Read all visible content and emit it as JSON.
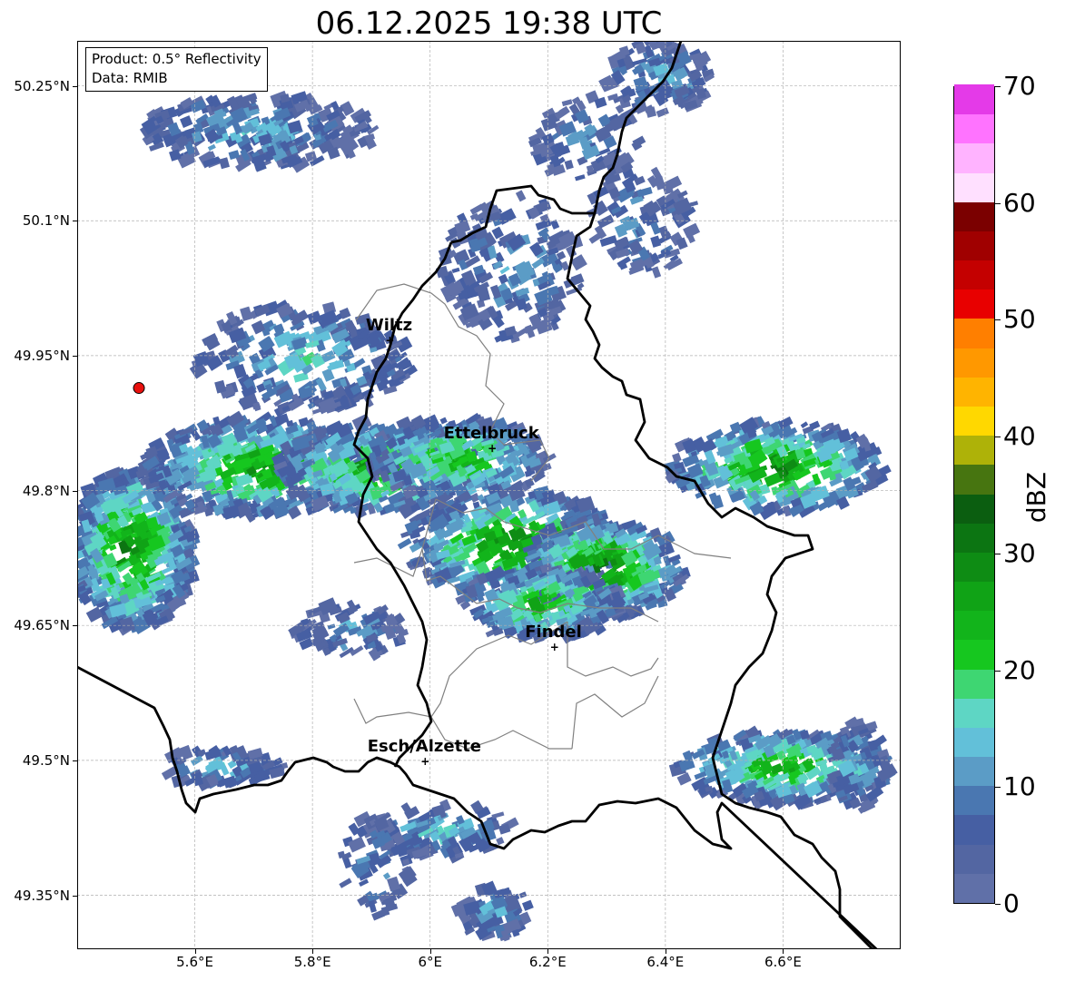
{
  "title": "06.12.2025 19:38 UTC",
  "info_box": {
    "product": "Product: 0.5° Reflectivity",
    "data_source": "Data: RMIB"
  },
  "map_extent": {
    "lon": [
      5.4,
      6.8
    ],
    "lat": [
      49.29,
      50.3
    ]
  },
  "lat_ticks": [
    {
      "value": 50.25,
      "label": "50.25°N"
    },
    {
      "value": 50.1,
      "label": "50.1°N"
    },
    {
      "value": 49.95,
      "label": "49.95°N"
    },
    {
      "value": 49.8,
      "label": "49.8°N"
    },
    {
      "value": 49.65,
      "label": "49.65°N"
    },
    {
      "value": 49.5,
      "label": "49.5°N"
    },
    {
      "value": 49.35,
      "label": "49.35°N"
    }
  ],
  "lon_ticks": [
    {
      "value": 5.6,
      "label": "5.6°E"
    },
    {
      "value": 5.8,
      "label": "5.8°E"
    },
    {
      "value": 6.0,
      "label": "6°E"
    },
    {
      "value": 6.2,
      "label": "6.2°E"
    },
    {
      "value": 6.4,
      "label": "6.4°E"
    },
    {
      "value": 6.6,
      "label": "6.6°E"
    }
  ],
  "cities": [
    {
      "name": "Wiltz",
      "lon": 5.93,
      "lat": 49.967
    },
    {
      "name": "Ettelbruck",
      "lon": 6.104,
      "lat": 49.847
    },
    {
      "name": "Findel",
      "lon": 6.21,
      "lat": 49.626
    },
    {
      "name": "Esch/Alzette",
      "lon": 5.99,
      "lat": 49.499
    }
  ],
  "radar_site": {
    "lon": 5.505,
    "lat": 49.914,
    "color": "#e8110e"
  },
  "colorbar": {
    "label": "dBZ",
    "min": 0,
    "max": 70,
    "ticks": [
      0,
      10,
      20,
      30,
      40,
      50,
      60,
      70
    ],
    "colors": [
      "#6070a8",
      "#5366a2",
      "#465fa3",
      "#4a77b1",
      "#5b9cc6",
      "#62c0d9",
      "#5ed6c4",
      "#3ed672",
      "#16c71f",
      "#12b41b",
      "#10a316",
      "#0e8c14",
      "#0c7512",
      "#0b5e10",
      "#477510",
      "#aeb208",
      "#ffd800",
      "#ffb400",
      "#ff9800",
      "#ff7f00",
      "#e80000",
      "#c40000",
      "#a00000",
      "#7b0000",
      "#ffe0ff",
      "#ffb3ff",
      "#ff73ff",
      "#e43ae8"
    ]
  }
}
